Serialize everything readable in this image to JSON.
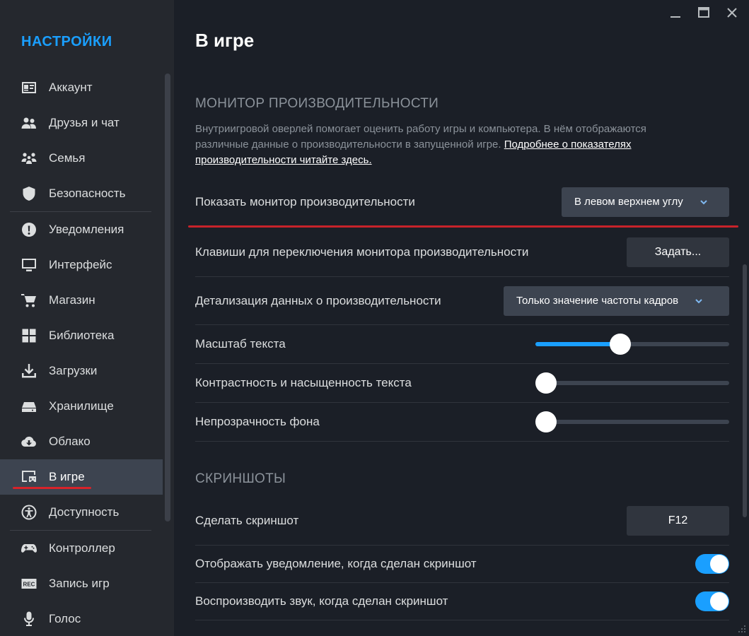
{
  "sidebar": {
    "title": "НАСТРОЙКИ",
    "items": [
      {
        "label": "Аккаунт",
        "icon": "account-card-icon"
      },
      {
        "label": "Друзья и чат",
        "icon": "friends-icon"
      },
      {
        "label": "Семья",
        "icon": "family-icon"
      },
      {
        "label": "Безопасность",
        "icon": "shield-icon"
      },
      {
        "label": "Уведомления",
        "icon": "alert-icon"
      },
      {
        "label": "Интерфейс",
        "icon": "monitor-icon"
      },
      {
        "label": "Магазин",
        "icon": "cart-icon"
      },
      {
        "label": "Библиотека",
        "icon": "grid-icon"
      },
      {
        "label": "Загрузки",
        "icon": "download-icon"
      },
      {
        "label": "Хранилище",
        "icon": "storage-icon"
      },
      {
        "label": "Облако",
        "icon": "cloud-icon"
      },
      {
        "label": "В игре",
        "icon": "in-game-icon",
        "active": true
      },
      {
        "label": "Доступность",
        "icon": "accessibility-icon"
      },
      {
        "label": "Контроллер",
        "icon": "gamepad-icon"
      },
      {
        "label": "Запись игр",
        "icon": "rec-icon"
      },
      {
        "label": "Голос",
        "icon": "microphone-icon"
      }
    ]
  },
  "main": {
    "title": "В игре",
    "perf_section": {
      "title": "МОНИТОР ПРОИЗВОДИТЕЛЬНОСТИ",
      "description": "Внутриигровой оверлей помогает оценить работу игры и компьютера. В нём отображаются различные данные о производительности в запущенной игре. ",
      "link": "Подробнее о показателях производительности читайте здесь."
    },
    "rows": {
      "show_monitor": {
        "label": "Показать монитор производительности",
        "value": "В левом верхнем углу"
      },
      "hotkey": {
        "label": "Клавиши для переключения монитора производительности",
        "button": "Задать..."
      },
      "detail": {
        "label": "Детализация данных о производительности",
        "value": "Только значение частоты кадров"
      },
      "text_scale": {
        "label": "Масштаб текста",
        "level": 0.43
      },
      "text_contrast": {
        "label": "Контрастность и насыщенность текста",
        "level": 0.0
      },
      "bg_opacity": {
        "label": "Непрозрачность фона",
        "level": 0.0
      }
    },
    "screenshot_section": {
      "title": "СКРИНШОТЫ",
      "take": {
        "label": "Сделать скриншот",
        "key": "F12"
      },
      "notify": {
        "label": "Отображать уведомление, когда сделан скриншот",
        "on": true
      },
      "sound": {
        "label": "Воспроизводить звук, когда сделан скриншот",
        "on": true
      }
    }
  },
  "colors": {
    "accent": "#1a9fff",
    "annotation_red": "#d8232a",
    "sidebar_bg": "#25282e",
    "main_bg": "#1b1f27"
  }
}
